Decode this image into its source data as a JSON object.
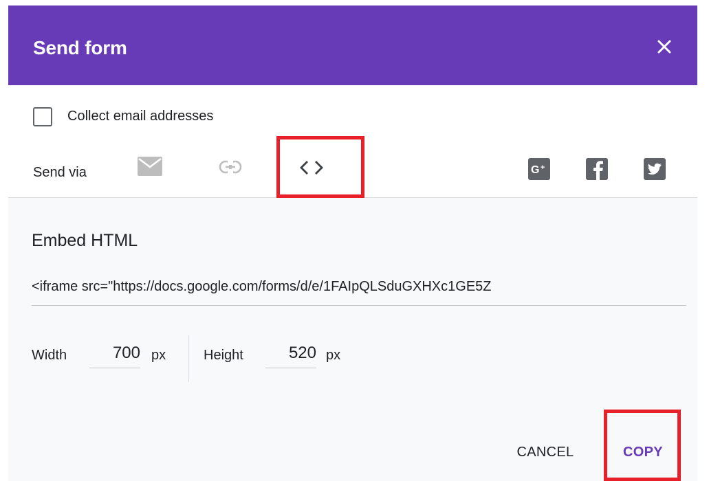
{
  "dialog": {
    "title": "Send form",
    "close_icon": "close-icon"
  },
  "options": {
    "collect_email_label": "Collect email addresses",
    "collect_email_checked": false
  },
  "send_via": {
    "label": "Send via",
    "methods": [
      {
        "name": "email",
        "icon": "email-icon",
        "selected": false
      },
      {
        "name": "link",
        "icon": "link-icon",
        "selected": false
      },
      {
        "name": "embed",
        "icon": "code-brackets-icon",
        "selected": true
      }
    ],
    "social": [
      {
        "name": "google-plus",
        "icon": "google-plus-icon"
      },
      {
        "name": "facebook",
        "icon": "facebook-icon"
      },
      {
        "name": "twitter",
        "icon": "twitter-icon"
      }
    ]
  },
  "embed": {
    "heading": "Embed HTML",
    "code": "<iframe src=\"https://docs.google.com/forms/d/e/1FAIpQLSduGXHXc1GE5Z",
    "width_label": "Width",
    "width_value": "700",
    "height_label": "Height",
    "height_value": "520",
    "unit": "px"
  },
  "actions": {
    "cancel_label": "CANCEL",
    "copy_label": "COPY"
  },
  "colors": {
    "header": "#673ab7",
    "accent": "#673ab7",
    "highlight": "#e8202a",
    "icon_gray": "#bdbdbd",
    "social_gray": "#5f6368"
  }
}
